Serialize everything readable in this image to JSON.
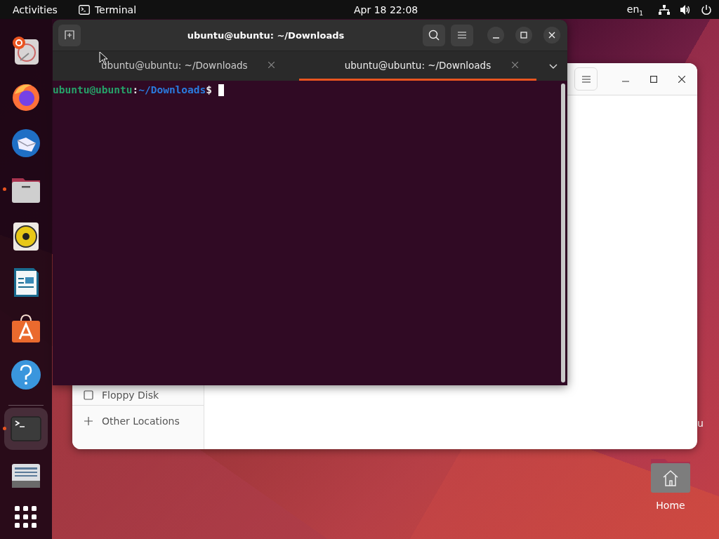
{
  "top_bar": {
    "activities": "Activities",
    "app_menu": "Terminal",
    "clock": "Apr 18  22:08",
    "keyboard": "en$_{1}$"
  },
  "dock": {
    "favorites": [
      {
        "kind": "installer",
        "running": false,
        "selected": false
      },
      {
        "kind": "browser",
        "running": false,
        "selected": false
      },
      {
        "kind": "mail",
        "running": false,
        "selected": false
      },
      {
        "kind": "files",
        "running": true,
        "selected": false
      },
      {
        "kind": "music",
        "running": false,
        "selected": false
      },
      {
        "kind": "writer",
        "running": false,
        "selected": false
      },
      {
        "kind": "store",
        "running": false,
        "selected": false
      },
      {
        "kind": "help",
        "running": false,
        "selected": false
      }
    ],
    "others": [
      {
        "kind": "terminal",
        "running": true,
        "selected": true
      },
      {
        "kind": "archive",
        "running": false,
        "selected": false
      }
    ]
  },
  "files_window": {
    "sidebar": [
      {
        "kind": "drive",
        "label": "Floppy Disk"
      },
      {
        "kind": "other",
        "label": "Other Locations"
      }
    ]
  },
  "desktop": {
    "icons": [
      {
        "kind": "hidden",
        "label": "u"
      },
      {
        "kind": "home",
        "label": "Home"
      }
    ]
  },
  "terminal": {
    "title": "ubuntu@ubuntu: ~/Downloads",
    "tabs": [
      {
        "label": "ubuntu@ubuntu: ~/Downloads",
        "selected": false
      },
      {
        "label": "ubuntu@ubuntu: ~/Downloads",
        "selected": true
      }
    ],
    "prompt": {
      "user_host": "ubuntu@ubuntu",
      "separator": ":",
      "path": "~/Downloads",
      "symbol": "$"
    }
  }
}
